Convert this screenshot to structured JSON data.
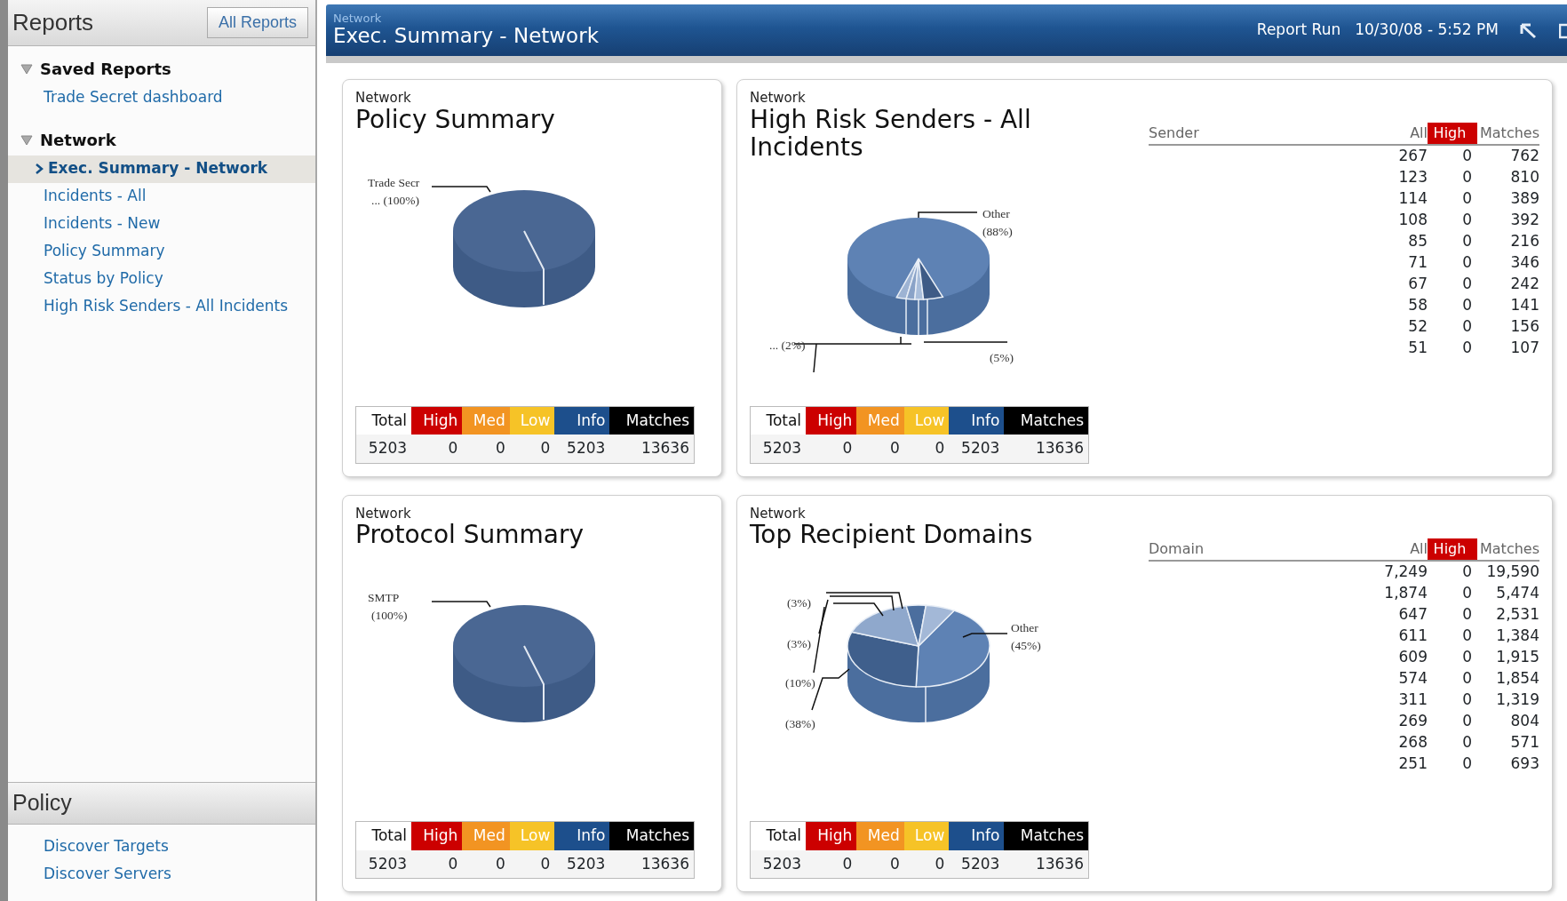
{
  "sidebar": {
    "title": "Reports",
    "button": "All Reports",
    "groups": [
      {
        "label": "Saved Reports",
        "expanded": true,
        "items": [
          {
            "label": "Trade Secret dashboard",
            "selected": false
          }
        ]
      },
      {
        "label": "Network",
        "expanded": true,
        "items": [
          {
            "label": "Exec. Summary - Network",
            "selected": true
          },
          {
            "label": "Incidents - All",
            "selected": false
          },
          {
            "label": "Incidents - New",
            "selected": false
          },
          {
            "label": "Policy Summary",
            "selected": false
          },
          {
            "label": "Status by Policy",
            "selected": false
          },
          {
            "label": "High Risk Senders - All Incidents",
            "selected": false
          }
        ]
      }
    ],
    "bottom_section": {
      "title": "Policy",
      "items": [
        {
          "label": "Discover Targets",
          "selected": false
        },
        {
          "label": "Discover Servers",
          "selected": false
        }
      ]
    }
  },
  "header": {
    "overline": "Network",
    "title": "Exec. Summary - Network",
    "run_label": "Report Run",
    "run_time": "10/30/08 - 5:52 PM"
  },
  "cards": [
    {
      "overline": "Network",
      "title": "Policy Summary",
      "kind": "single",
      "pie_labels": [
        "Trade Secr",
        "... (100%)"
      ],
      "severity": {
        "columns": [
          {
            "label": "Total",
            "color": "#ffffff"
          },
          {
            "label": "High",
            "color": "#cc0000"
          },
          {
            "label": "Med",
            "color": "#f29422"
          },
          {
            "label": "Low",
            "color": "#f6c327"
          },
          {
            "label": "Info",
            "color": "#1d4f8c"
          },
          {
            "label": "Matches",
            "color": "#000000"
          }
        ],
        "values": [
          "5203",
          "0",
          "0",
          "0",
          "5203",
          "13636"
        ]
      }
    },
    {
      "overline": "Network",
      "title": "High Risk Senders - All Incidents",
      "kind": "senders",
      "pie_labels": [
        "Other",
        "(88%)",
        "... (2%)",
        "(5%)"
      ],
      "severity": {
        "columns": [
          {
            "label": "Total",
            "color": "#ffffff"
          },
          {
            "label": "High",
            "color": "#cc0000"
          },
          {
            "label": "Med",
            "color": "#f29422"
          },
          {
            "label": "Low",
            "color": "#f6c327"
          },
          {
            "label": "Info",
            "color": "#1d4f8c"
          },
          {
            "label": "Matches",
            "color": "#000000"
          }
        ],
        "values": [
          "5203",
          "0",
          "0",
          "0",
          "5203",
          "13636"
        ]
      },
      "table": {
        "columns": [
          {
            "label": "Sender",
            "highlighted": false
          },
          {
            "label": "All",
            "highlighted": false
          },
          {
            "label": "High",
            "highlighted": true
          },
          {
            "label": "Matches",
            "highlighted": false
          }
        ],
        "rows": [
          {
            "all": "267",
            "high": "0",
            "matches": "762"
          },
          {
            "all": "123",
            "high": "0",
            "matches": "810"
          },
          {
            "all": "114",
            "high": "0",
            "matches": "389"
          },
          {
            "all": "108",
            "high": "0",
            "matches": "392"
          },
          {
            "all": "85",
            "high": "0",
            "matches": "216"
          },
          {
            "all": "71",
            "high": "0",
            "matches": "346"
          },
          {
            "all": "67",
            "high": "0",
            "matches": "242"
          },
          {
            "all": "58",
            "high": "0",
            "matches": "141"
          },
          {
            "all": "52",
            "high": "0",
            "matches": "156"
          },
          {
            "all": "51",
            "high": "0",
            "matches": "107"
          }
        ]
      }
    },
    {
      "overline": "Network",
      "title": "Protocol Summary",
      "kind": "single",
      "pie_labels": [
        "SMTP",
        "(100%)"
      ],
      "severity": {
        "columns": [
          {
            "label": "Total",
            "color": "#ffffff"
          },
          {
            "label": "High",
            "color": "#cc0000"
          },
          {
            "label": "Med",
            "color": "#f29422"
          },
          {
            "label": "Low",
            "color": "#f6c327"
          },
          {
            "label": "Info",
            "color": "#1d4f8c"
          },
          {
            "label": "Matches",
            "color": "#000000"
          }
        ],
        "values": [
          "5203",
          "0",
          "0",
          "0",
          "5203",
          "13636"
        ]
      }
    },
    {
      "overline": "Network",
      "title": "Top Recipient Domains",
      "kind": "domains",
      "pie_labels": [
        "(3%)",
        "(3%)",
        "(10%)",
        "(38%)",
        "Other",
        "(45%)"
      ],
      "severity": {
        "columns": [
          {
            "label": "Total",
            "color": "#ffffff"
          },
          {
            "label": "High",
            "color": "#cc0000"
          },
          {
            "label": "Med",
            "color": "#f29422"
          },
          {
            "label": "Low",
            "color": "#f6c327"
          },
          {
            "label": "Info",
            "color": "#1d4f8c"
          },
          {
            "label": "Matches",
            "color": "#000000"
          }
        ],
        "values": [
          "5203",
          "0",
          "0",
          "0",
          "5203",
          "13636"
        ]
      },
      "table": {
        "columns": [
          {
            "label": "Domain",
            "highlighted": false
          },
          {
            "label": "All",
            "highlighted": false
          },
          {
            "label": "High",
            "highlighted": true
          },
          {
            "label": "Matches",
            "highlighted": false
          }
        ],
        "rows": [
          {
            "all": "7,249",
            "high": "0",
            "matches": "19,590"
          },
          {
            "all": "1,874",
            "high": "0",
            "matches": "5,474"
          },
          {
            "all": "647",
            "high": "0",
            "matches": "2,531"
          },
          {
            "all": "611",
            "high": "0",
            "matches": "1,384"
          },
          {
            "all": "609",
            "high": "0",
            "matches": "1,915"
          },
          {
            "all": "574",
            "high": "0",
            "matches": "1,854"
          },
          {
            "all": "311",
            "high": "0",
            "matches": "1,319"
          },
          {
            "all": "269",
            "high": "0",
            "matches": "804"
          },
          {
            "all": "268",
            "high": "0",
            "matches": "571"
          },
          {
            "all": "251",
            "high": "0",
            "matches": "693"
          }
        ]
      }
    }
  ]
}
